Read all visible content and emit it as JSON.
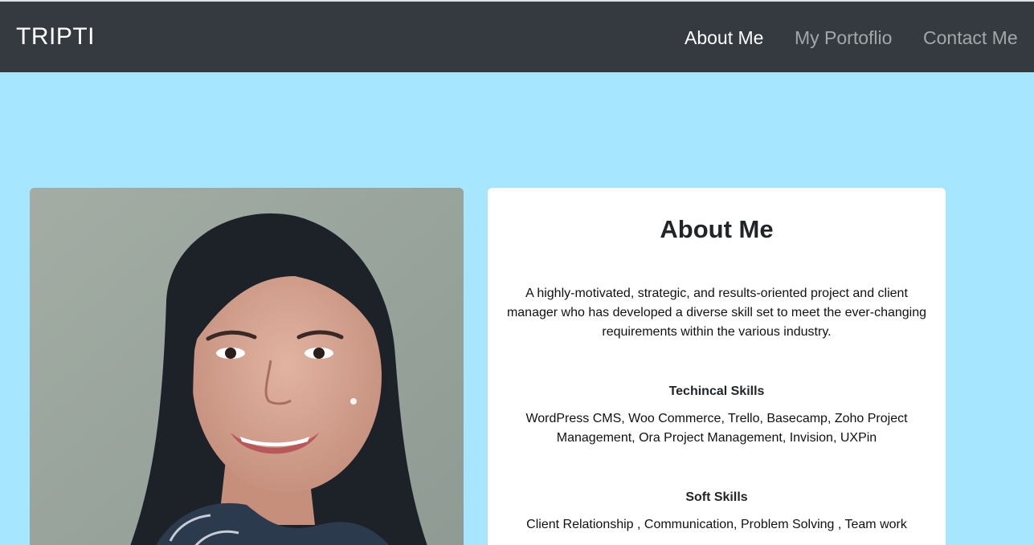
{
  "navbar": {
    "brand": "TRIPTI",
    "links": [
      {
        "label": "About Me",
        "active": true
      },
      {
        "label": "My Portoflio",
        "active": false
      },
      {
        "label": "Contact Me",
        "active": false
      }
    ],
    "background": "#343a40"
  },
  "page": {
    "background": "#a6e6fe"
  },
  "photo": {
    "alt": "portrait photo"
  },
  "about": {
    "title": "About Me",
    "intro": "A highly-motivated, strategic, and results-oriented project and client manager who has developed a diverse skill set to meet the ever-changing requirements within the various industry.",
    "technical_title": "Techincal Skills",
    "technical_text": "WordPress CMS, Woo Commerce, Trello, Basecamp, Zoho Project Management, Ora Project Management, Invision, UXPin",
    "soft_title": "Soft Skills",
    "soft_text": "Client Relationship , Communication, Problem Solving , Team work"
  }
}
